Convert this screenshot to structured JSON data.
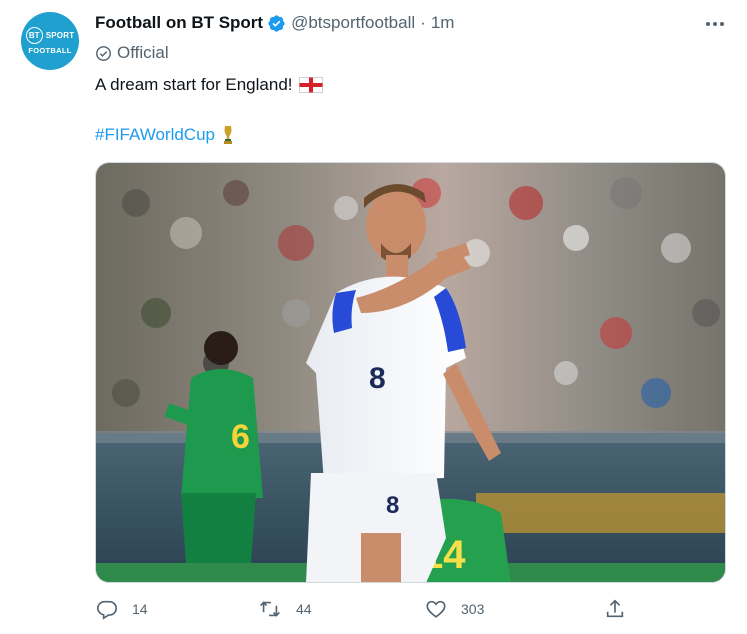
{
  "author": {
    "display_name": "Football on BT Sport",
    "handle": "@btsportfootball",
    "time": "1m",
    "label": "Official",
    "avatar_text_top": "SPORT",
    "avatar_text_bt": "BT",
    "avatar_text_bottom": "FOOTBALL"
  },
  "tweet": {
    "text": "A dream start for England!",
    "hashtag": "#FIFAWorldCup",
    "flag_icon": "england-flag-icon",
    "trophy_icon": "trophy-icon"
  },
  "media": {
    "jersey_number_main": "8",
    "jersey_number_back": "14",
    "jersey_number_left": "6"
  },
  "actions": {
    "reply_count": "14",
    "retweet_count": "44",
    "like_count": "303"
  },
  "colors": {
    "accent": "#1d9bf0",
    "avatar_bg": "#1fa0cf",
    "muted": "#536471",
    "text": "#0f1419"
  }
}
